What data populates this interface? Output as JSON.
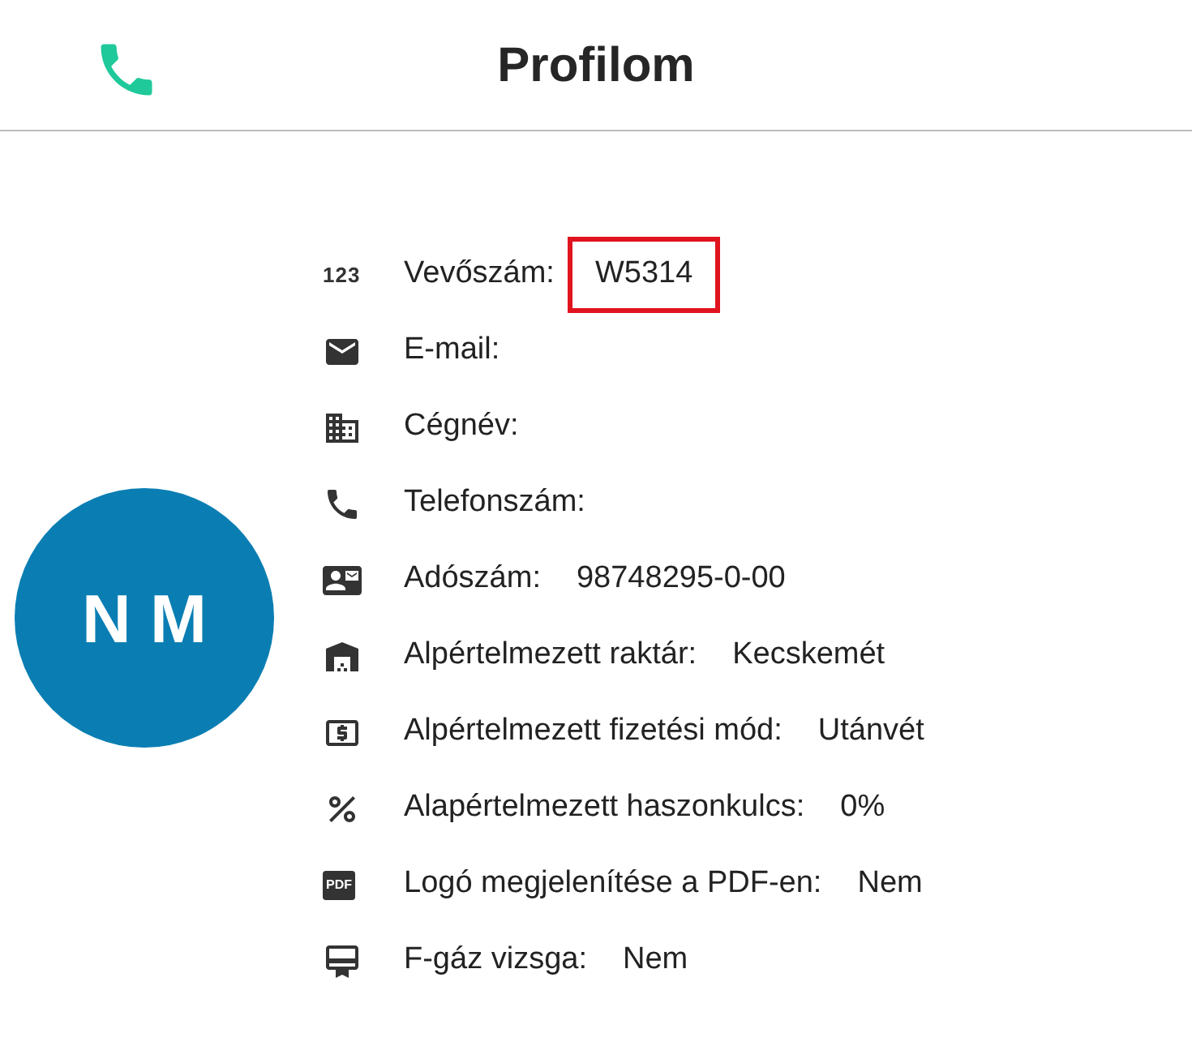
{
  "header": {
    "title": "Profilom"
  },
  "avatar": {
    "initials": "N M"
  },
  "fields": [
    {
      "kind": "number",
      "icon_text": "123",
      "label": "Vevőszám:",
      "value": "W5314",
      "highlighted": true
    },
    {
      "kind": "email",
      "label": "E-mail:",
      "highlighted": false
    },
    {
      "kind": "company",
      "label": "Cégnév:",
      "highlighted": false
    },
    {
      "kind": "phone",
      "label": "Telefonszám:",
      "highlighted": false
    },
    {
      "kind": "id",
      "label": "Adószám:",
      "value": "98748295-0-00",
      "highlighted": false
    },
    {
      "kind": "warehouse",
      "label": "Alpértelmezett raktár:",
      "value": "Kecskemét",
      "highlighted": false
    },
    {
      "kind": "money",
      "label": "Alpértelmezett fizetési mód:",
      "value": "Utánvét",
      "highlighted": false
    },
    {
      "kind": "percent",
      "label": "Alapértelmezett haszonkulcs:",
      "value": "0%",
      "highlighted": false
    },
    {
      "kind": "pdf",
      "icon_text": "PDF",
      "label": "Logó megjelenítése a PDF-en:",
      "value": "Nem",
      "highlighted": false
    },
    {
      "kind": "certificate",
      "label": "F-gáz vizsga:",
      "value": "Nem",
      "highlighted": false
    }
  ]
}
